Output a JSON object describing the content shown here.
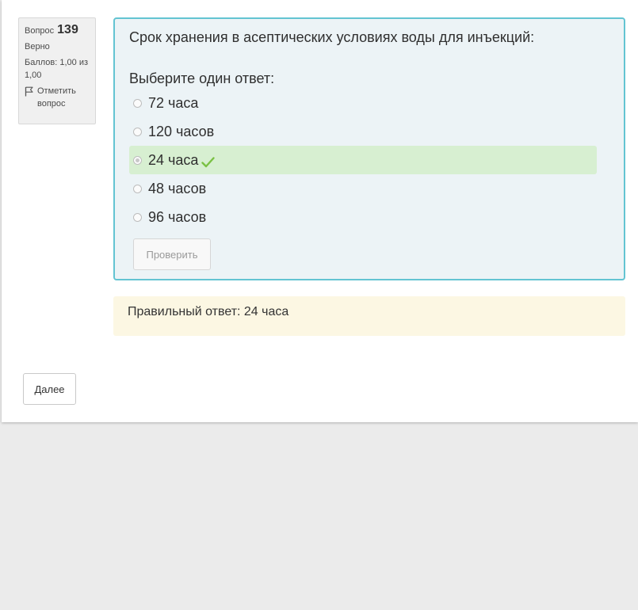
{
  "question_info": {
    "label": "Вопрос",
    "number": "139",
    "state": "Верно",
    "grade": "Баллов: 1,00 из 1,00",
    "flag_icon": "flag-icon",
    "flag_label": "Отметить вопрос"
  },
  "question": {
    "text": "Срок хранения в асептических условиях воды для инъекций:",
    "prompt": "Выберите один ответ:",
    "options": [
      {
        "label": "72 часа",
        "selected": false,
        "correct": false
      },
      {
        "label": "120 часов",
        "selected": false,
        "correct": false
      },
      {
        "label": "24 часа",
        "selected": true,
        "correct": true
      },
      {
        "label": "48 часов",
        "selected": false,
        "correct": false
      },
      {
        "label": "96 часов",
        "selected": false,
        "correct": false
      }
    ],
    "check_button": "Проверить"
  },
  "feedback": {
    "right_answer": "Правильный ответ: 24 часа"
  },
  "navigation": {
    "next_button": "Далее"
  },
  "colors": {
    "formulation_bg": "#ecf3f6",
    "formulation_border": "#63c4d2",
    "correct_bg": "#d7efd1",
    "tick": "#7ac143",
    "feedback_bg": "#fcf7e3"
  }
}
